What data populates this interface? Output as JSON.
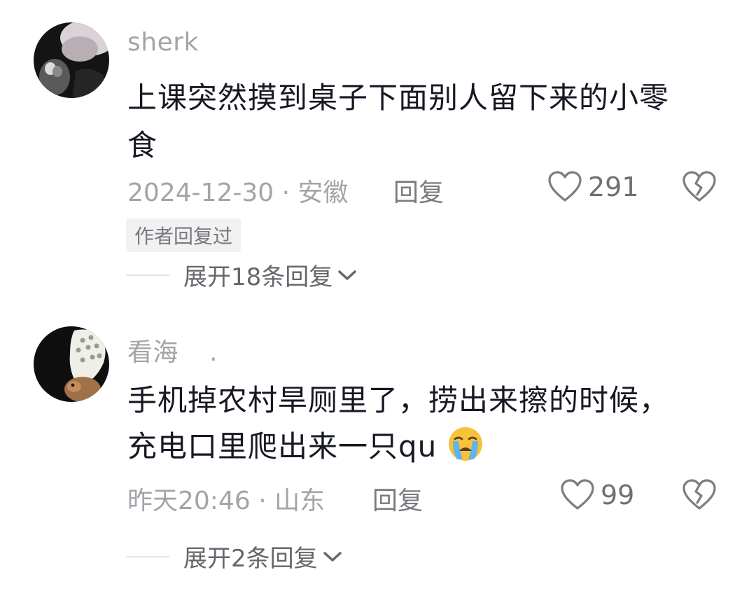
{
  "comments": [
    {
      "username": "sherk",
      "lines": [
        "上课突然摸到桌子下面别人留下来的小零",
        "食"
      ],
      "time_location": "2024-12-30 · 安徽",
      "reply_label": "回复",
      "like_count": "291",
      "author_badge": "作者回复过",
      "expand_label": "展开18条回复"
    },
    {
      "username": "看海",
      "username_suffix": ".",
      "lines": [
        "手机掉农村旱厕里了，捞出来擦的时候，",
        "充电口里爬出来一只qu"
      ],
      "emoji": "crying-face",
      "time_location": "昨天20:46 · 山东",
      "reply_label": "回复",
      "like_count": "99",
      "expand_label": "展开2条回复"
    }
  ]
}
